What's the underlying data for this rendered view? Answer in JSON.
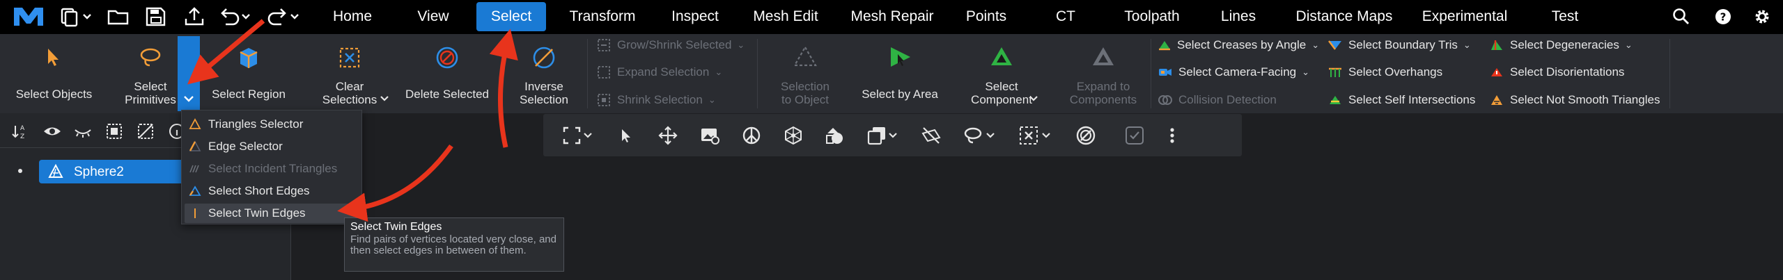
{
  "menu": {
    "items": [
      "Home",
      "View",
      "Select",
      "Transform",
      "Inspect",
      "Mesh Edit",
      "Mesh Repair",
      "Points",
      "CT",
      "Toolpath",
      "Lines",
      "Distance Maps",
      "Experimental",
      "Test"
    ],
    "active": "Select"
  },
  "ribbon": {
    "select_objects": "Select Objects",
    "select_primitives_1": "Select",
    "select_primitives_2": "Primitives",
    "select_region": "Select Region",
    "clear_selections_1": "Clear",
    "clear_selections_2": "Selections",
    "delete_selected": "Delete Selected",
    "inverse_selection_1": "Inverse",
    "inverse_selection_2": "Selection",
    "grow_shrink": "Grow/Shrink Selected",
    "expand_selection": "Expand Selection",
    "shrink_selection": "Shrink Selection",
    "selection_to_object_1": "Selection",
    "selection_to_object_2": "to Object",
    "select_by_area": "Select by Area",
    "select_component_1": "Select",
    "select_component_2": "Component",
    "expand_to_components_1": "Expand to",
    "expand_to_components_2": "Components",
    "select_creases": "Select Creases by Angle",
    "select_camera_facing": "Select Camera-Facing",
    "collision_detection": "Collision Detection",
    "select_boundary_tris": "Select Boundary Tris",
    "select_overhangs": "Select Overhangs",
    "select_self_intersections": "Select Self Intersections",
    "select_degeneracies": "Select Degeneracies",
    "select_disorientations": "Select Disorientations",
    "select_not_smooth": "Select Not Smooth Triangles"
  },
  "tree": {
    "item": "Sphere2"
  },
  "dropdown": {
    "items": [
      "Triangles Selector",
      "Edge Selector",
      "Select Incident Triangles",
      "Select Short Edges",
      "Select Twin Edges"
    ]
  },
  "tooltip": {
    "title": "Select Twin Edges",
    "description": "Find pairs of vertices located very close, and then select edges in between of them."
  },
  "colors": {
    "accent": "#1a7ad4",
    "annotation_arrow": "#e8341c"
  }
}
